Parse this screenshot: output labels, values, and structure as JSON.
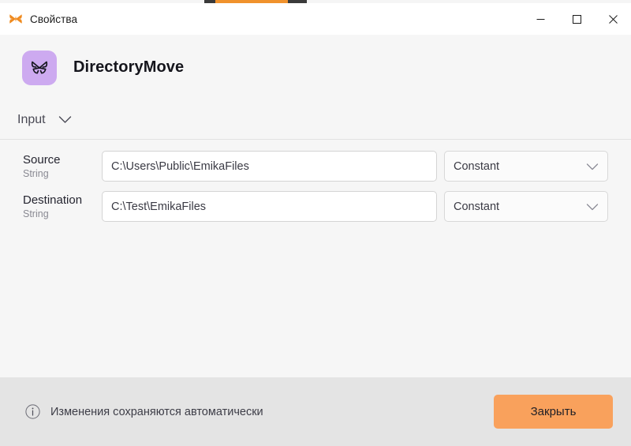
{
  "titlebar": {
    "icon": "butterfly-icon",
    "title": "Свойства",
    "controls": {
      "minimize": "minimize-icon",
      "maximize": "maximize-icon",
      "close": "close-icon"
    }
  },
  "app_header": {
    "logo_icon": "butterfly-icon",
    "logo_bg": "#cdaaf0",
    "title": "DirectoryMove"
  },
  "section": {
    "label": "Input",
    "chevron": "chevron-down-icon",
    "expanded": true
  },
  "fields": [
    {
      "name": "Source",
      "type": "String",
      "value": "C:\\Users\\Public\\EmikaFiles",
      "placeholder": "",
      "mode": "Constant",
      "mode_chevron": "chevron-down-icon"
    },
    {
      "name": "Destination",
      "type": "String",
      "value": "C:\\Test\\EmikaFiles",
      "placeholder": "",
      "mode": "Constant",
      "mode_chevron": "chevron-down-icon"
    }
  ],
  "footer": {
    "info_icon": "info-circle-icon",
    "info_text": "Изменения сохраняются автоматически",
    "close_label": "Закрыть",
    "close_color": "#f9a15c"
  }
}
